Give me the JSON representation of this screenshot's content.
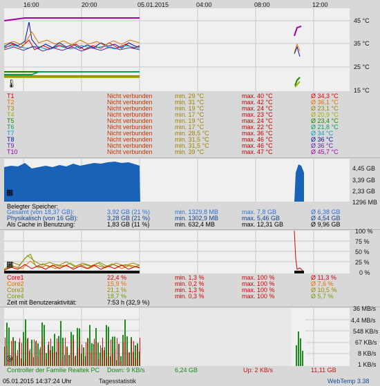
{
  "header": {
    "time_labels": [
      "16:00",
      "20:00",
      "05.01.2015",
      "04:00",
      "08:00",
      "12:00"
    ]
  },
  "temp_axis": [
    "45 °C",
    "35 °C",
    "25 °C",
    "15 °C"
  ],
  "temps": [
    {
      "name": "T1",
      "status": "Nicht verbunden",
      "min": "min. 29 °C",
      "max": "max. 40 °C",
      "avg": "Ø 34,3 °C",
      "color": "#d40000"
    },
    {
      "name": "T2",
      "status": "Nicht verbunden",
      "min": "min. 31 °C",
      "max": "max. 42 °C",
      "avg": "Ø 36,1 °C",
      "color": "#e07000"
    },
    {
      "name": "T3",
      "status": "Nicht verbunden",
      "min": "min. 19 °C",
      "max": "max. 24 °C",
      "avg": "Ø 23,1 °C",
      "color": "#9a8a00"
    },
    {
      "name": "T4",
      "status": "Nicht verbunden",
      "min": "min. 17 °C",
      "max": "max. 23 °C",
      "avg": "Ø 20,9 °C",
      "color": "#a0b000"
    },
    {
      "name": "T5",
      "status": "Nicht verbunden",
      "min": "min. 19 °C",
      "max": "max. 24 °C",
      "avg": "Ø 23,4 °C",
      "color": "#208000"
    },
    {
      "name": "T6",
      "status": "Nicht verbunden",
      "min": "min. 17 °C",
      "max": "max. 22 °C",
      "avg": "Ø 21,8 °C",
      "color": "#00a060"
    },
    {
      "name": "T7",
      "status": "Nicht verbunden",
      "min": "min. 28,5 °C",
      "max": "max. 36 °C",
      "avg": "Ø 34 °C",
      "color": "#00a0c0"
    },
    {
      "name": "T8",
      "status": "Nicht verbunden",
      "min": "min. 31,5 °C",
      "max": "max. 46 °C",
      "avg": "Ø 36 °C",
      "color": "#0010a0"
    },
    {
      "name": "T9",
      "status": "Nicht verbunden",
      "min": "min. 31,5 °C",
      "max": "max. 46 °C",
      "avg": "Ø 36 °C",
      "color": "#6020a0"
    },
    {
      "name": "T10",
      "status": "Nicht verbunden",
      "min": "min. 39 °C",
      "max": "max. 47 °C",
      "avg": "Ø 45,7 °C",
      "color": "#a000a0"
    }
  ],
  "mem_axis": [
    "4,45 GB",
    "3,39 GB",
    "2,33 GB",
    "1296 MB"
  ],
  "mem": {
    "title": "Belegter Speicher:",
    "rows": [
      {
        "name": "Gesamt (von 18,37 GB):",
        "value": "3,92 GB (21 %)",
        "min": "min. 1329,8 MB",
        "max": "max. 7,8 GB",
        "avg": "Ø 6,38 GB",
        "color": "#3070d0"
      },
      {
        "name": "Physikalisch (von 16 GB):",
        "value": "3,28 GB (21 %)",
        "min": "min. 1302,9 MB",
        "max": "max. 5,46 GB",
        "avg": "Ø 4,54 GB",
        "color": "#104090"
      },
      {
        "name": "Als Cache in Benutzung:",
        "value": "1,83 GB (11 %)",
        "min": "min. 632,4 MB",
        "max": "max. 12,31 GB",
        "avg": "Ø 9,96 GB",
        "color": "#000000"
      }
    ]
  },
  "cpu_axis": [
    "100 %",
    "75 %",
    "50 %",
    "25 %",
    "0 %"
  ],
  "cores": [
    {
      "name": "Core1",
      "value": "22,4 %",
      "min": "min. 1,3 %",
      "max": "max. 100 %",
      "avg": "Ø 11,3 %",
      "color": "#d40000"
    },
    {
      "name": "Core2",
      "value": "15,9 %",
      "min": "min. 0,2 %",
      "max": "max. 100 %",
      "avg": "Ø 7,6 %",
      "color": "#e07000"
    },
    {
      "name": "Core3",
      "value": "21,1 %",
      "min": "min. 1,3 %",
      "max": "max. 100 %",
      "avg": "Ø 10,5 %",
      "color": "#9a8a00"
    },
    {
      "name": "Core4",
      "value": "18,7 %",
      "min": "min. 0,3 %",
      "max": "max. 100 %",
      "avg": "Ø 5,7 %",
      "color": "#70a000"
    }
  ],
  "activity": {
    "label": "Zeit mit Benutzeraktivität:",
    "value": "7:53 h (32,9 %)"
  },
  "net_axis": [
    "36 MB/s",
    "4,4 MB/s",
    "548 KB/s",
    "67 KB/s",
    "8 KB/s",
    "1 KB/s"
  ],
  "net": {
    "controller": "Controller der Familie Realtek PC",
    "down": "Down: 9 KB/s",
    "down_total": "6,24 GB",
    "up": "Up: 2 KB/s",
    "up_total": "11,11 GB"
  },
  "footer": {
    "datetime": "05.01.2015 14:37:24 Uhr",
    "mode": "Tagesstatistik",
    "app": "WebTemp 3.38"
  },
  "colors": {
    "mem_fill": "#1a62b8",
    "grid": "#c8c8c8",
    "down": "#1a8a1a",
    "up": "#c81010"
  }
}
